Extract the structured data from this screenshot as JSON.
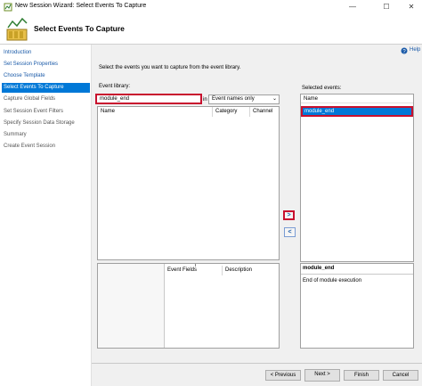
{
  "window": {
    "title": "New Session Wizard: Select Events To Capture",
    "minimize": "—",
    "maximize": "☐",
    "close": "✕"
  },
  "header": {
    "title": "Select Events To Capture"
  },
  "nav": {
    "items": [
      {
        "label": "Introduction"
      },
      {
        "label": "Set Session Properties"
      },
      {
        "label": "Choose Template"
      },
      {
        "label": "Select Events To Capture"
      },
      {
        "label": "Capture Global Fields"
      },
      {
        "label": "Set Session Event Filters"
      },
      {
        "label": "Specify Session Data Storage"
      },
      {
        "label": "Summary"
      },
      {
        "label": "Create Event Session"
      }
    ]
  },
  "main": {
    "help": "Help",
    "instruction": "Select the events you want to capture from the event library.",
    "library_label": "Event library:",
    "search_value": "module_end",
    "in_label": "in",
    "search_scope": "Event names only",
    "columns": {
      "name": "Name",
      "category": "Category",
      "channel": "Channel"
    },
    "fields_columns": {
      "event_fields": "Event Fields",
      "description": "Description"
    },
    "add_arrow": ">",
    "remove_arrow": "<",
    "selected_label": "Selected events:",
    "selected_header": "Name",
    "selected_items": [
      {
        "name": "module_end"
      }
    ],
    "detail_name": "module_end",
    "detail_desc": "End of module execution"
  },
  "footer": {
    "previous": "< Previous",
    "next": "Next >",
    "finish": "Finish",
    "cancel": "Cancel"
  },
  "colors": {
    "accent": "#0078d7",
    "highlight": "#c8102e",
    "link": "#1a5aa8"
  }
}
